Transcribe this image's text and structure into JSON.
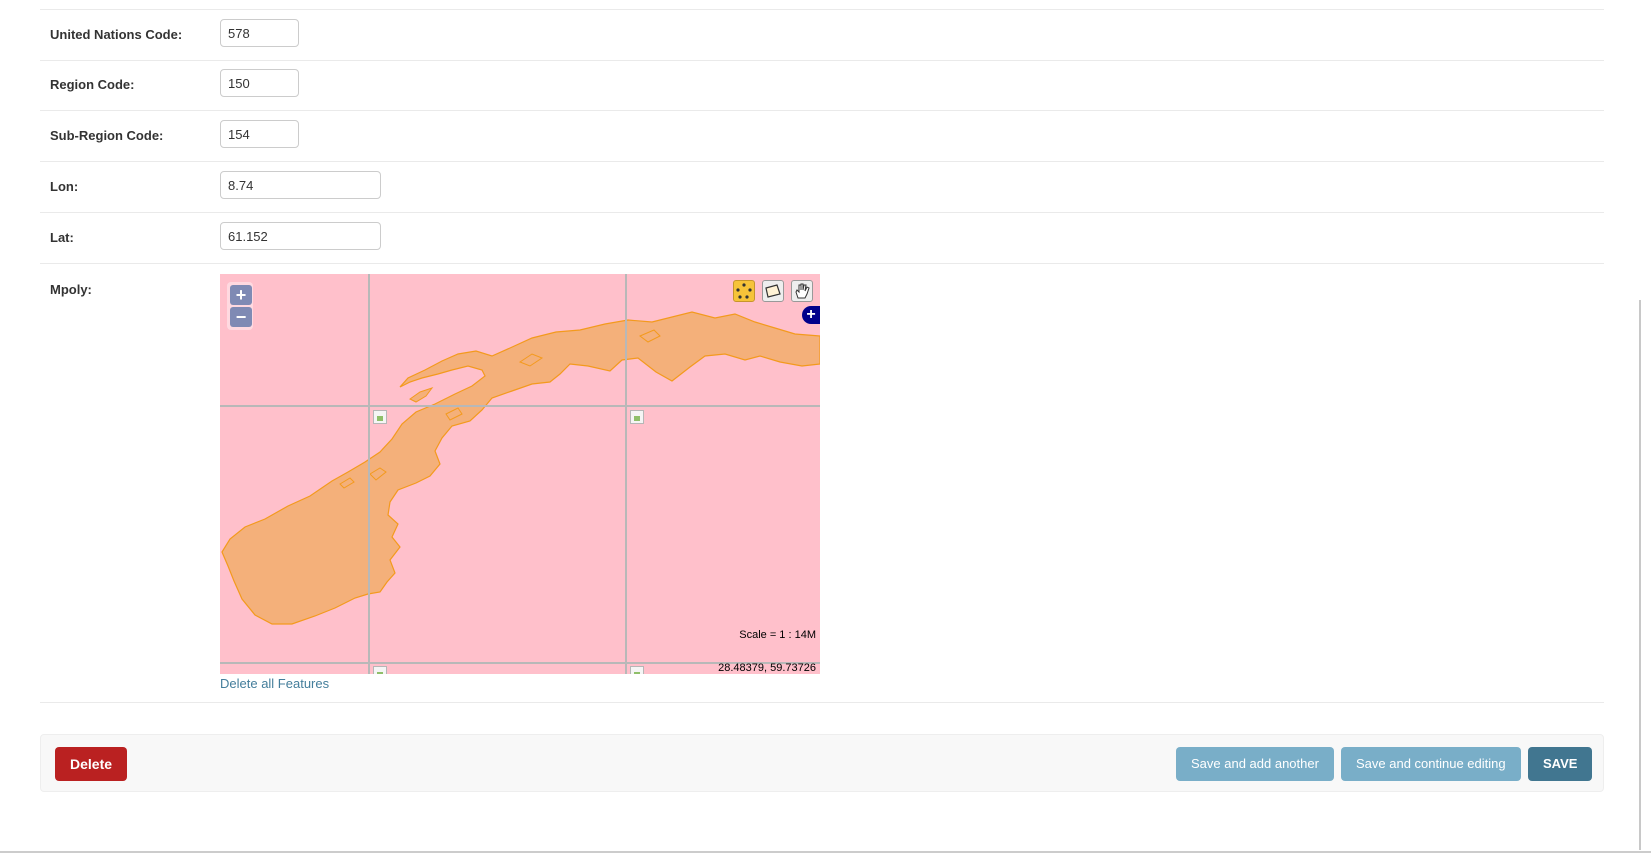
{
  "form": {
    "un_code": {
      "label": "United Nations Code:",
      "value": "578"
    },
    "region_code": {
      "label": "Region Code:",
      "value": "150"
    },
    "subregion_code": {
      "label": "Sub-Region Code:",
      "value": "154"
    },
    "lon": {
      "label": "Lon:",
      "value": "8.74"
    },
    "lat": {
      "label": "Lat:",
      "value": "61.152"
    },
    "mpoly": {
      "label": "Mpoly:"
    }
  },
  "map": {
    "zoom_in": "+",
    "zoom_out": "−",
    "layer_switcher": "+",
    "scale_text": "Scale = 1 : 14M",
    "coords_text": "28.48379, 59.73726",
    "delete_link": "Delete all Features",
    "colors": {
      "background": "#ffc0cb",
      "land_fill": "#f4b07a",
      "land_stroke": "#f39a1d"
    },
    "tools": [
      "draw-polygon-icon",
      "modify-feature-icon",
      "pan-hand-icon"
    ]
  },
  "actions": {
    "delete": "Delete",
    "save_add": "Save and add another",
    "save_continue": "Save and continue editing",
    "save": "SAVE"
  },
  "colors": {
    "delete": "#ba2121",
    "secondary": "#79aec8",
    "primary": "#417690",
    "link": "#447e9b"
  }
}
